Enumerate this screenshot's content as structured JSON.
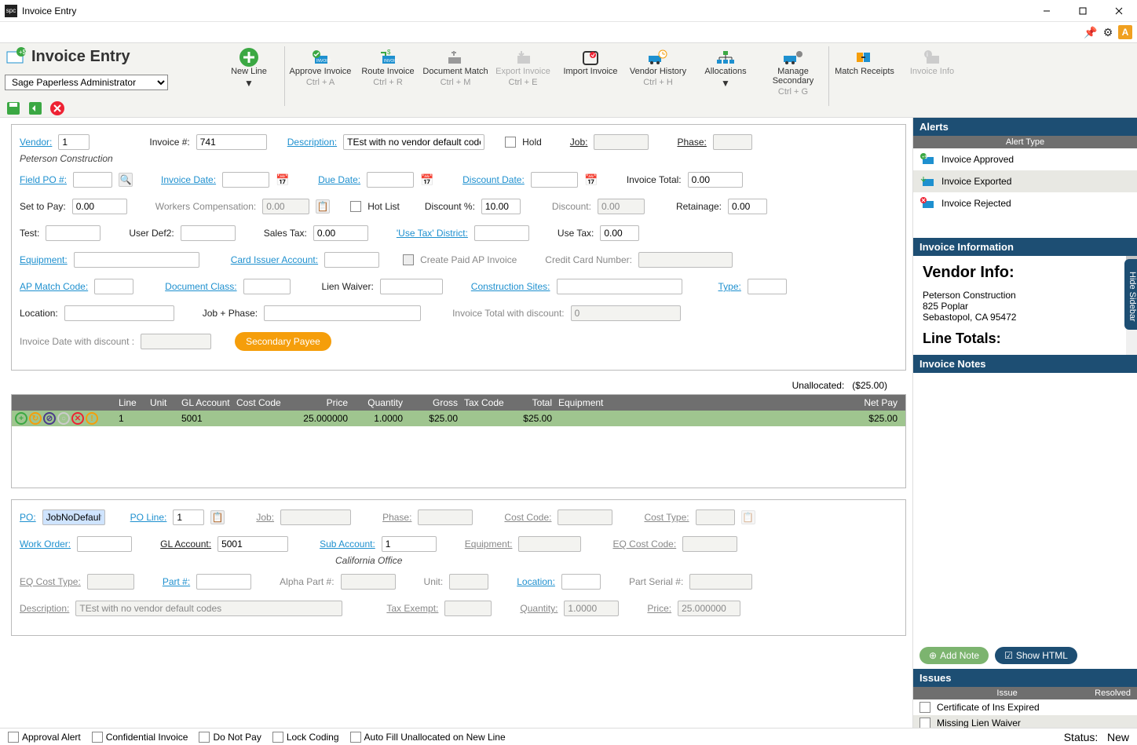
{
  "window": {
    "title": "Invoice Entry"
  },
  "page": {
    "title": "Invoice Entry",
    "admin": "Sage Paperless Administrator"
  },
  "tools": {
    "new_line": "New Line",
    "approve": "Approve Invoice",
    "approve_sc": "Ctrl + A",
    "route": "Route Invoice",
    "route_sc": "Ctrl + R",
    "docmatch": "Document Match",
    "docmatch_sc": "Ctrl + M",
    "export": "Export Invoice",
    "export_sc": "Ctrl + E",
    "import": "Import Invoice",
    "vendor_hist": "Vendor History",
    "vendor_hist_sc": "Ctrl + H",
    "alloc": "Allocations",
    "manage_sec": "Manage Secondary",
    "manage_sec_sc": "Ctrl + G",
    "match_rec": "Match Receipts",
    "inv_info": "Invoice Info"
  },
  "form": {
    "vendor_l": "Vendor:",
    "vendor_v": "1",
    "vendor_name": "Peterson Construction",
    "invno_l": "Invoice #:",
    "invno_v": "741",
    "desc_l": "Description:",
    "desc_v": "TEst with no vendor default codes",
    "hold_l": "Hold",
    "job_l": "Job:",
    "phase_l": "Phase:",
    "fieldpo_l": "Field PO #:",
    "invdate_l": "Invoice Date:",
    "duedate_l": "Due Date:",
    "discdate_l": "Discount Date:",
    "invtotal_l": "Invoice Total:",
    "invtotal_v": "0.00",
    "setpay_l": "Set to Pay:",
    "setpay_v": "0.00",
    "workcomp_l": "Workers Compensation:",
    "workcomp_v": "0.00",
    "hotlist_l": "Hot List",
    "discpct_l": "Discount %:",
    "discpct_v": "10.00",
    "discount_l": "Discount:",
    "discount_v": "0.00",
    "retain_l": "Retainage:",
    "retain_v": "0.00",
    "test_l": "Test:",
    "userdef2_l": "User Def2:",
    "salestax_l": "Sales Tax:",
    "salestax_v": "0.00",
    "usetaxdist_l": "'Use Tax' District:",
    "usetax_l": "Use Tax:",
    "usetax_v": "0.00",
    "equip_l": "Equipment:",
    "cardissuer_l": "Card Issuer Account:",
    "createpaid_l": "Create Paid AP Invoice",
    "ccnum_l": "Credit Card Number:",
    "apmatch_l": "AP Match Code:",
    "docclass_l": "Document Class:",
    "lienwaiver_l": "Lien Waiver:",
    "consites_l": "Construction Sites:",
    "type_l": "Type:",
    "location_l": "Location:",
    "jobphase_l": "Job + Phase:",
    "invtd_l": "Invoice Total with discount:",
    "invtd_v": "0",
    "invdd_l": "Invoice Date with discount :",
    "secpayee": "Secondary Payee"
  },
  "unallocated": {
    "label": "Unallocated:",
    "value": "($25.00)"
  },
  "grid": {
    "cols": [
      "Line",
      "Unit",
      "GL Account",
      "Cost Code",
      "Price",
      "Quantity",
      "Gross",
      "Tax Code",
      "Total",
      "Equipment",
      "Net Pay"
    ],
    "row": {
      "line": "1",
      "gl": "5001",
      "price": "25.000000",
      "qty": "1.0000",
      "gross": "$25.00",
      "total": "$25.00",
      "net": "$25.00"
    }
  },
  "detail": {
    "po_l": "PO:",
    "po_v": "JobNoDefault",
    "poline_l": "PO Line:",
    "poline_v": "1",
    "job_l": "Job:",
    "phase_l": "Phase:",
    "costcode_l": "Cost Code:",
    "costtype_l": "Cost Type:",
    "wo_l": "Work Order:",
    "gl_l": "GL Account:",
    "gl_v": "5001",
    "sub_l": "Sub Account:",
    "sub_v": "1",
    "sub_name": "California Office",
    "equip_l": "Equipment:",
    "eqcc_l": "EQ Cost Code:",
    "eqct_l": "EQ Cost Type:",
    "part_l": "Part #:",
    "alpha_l": "Alpha Part #:",
    "unit_l": "Unit:",
    "loc_l": "Location:",
    "serial_l": "Part Serial #:",
    "desc_l": "Description:",
    "desc_v": "TEst with no vendor default codes",
    "taxex_l": "Tax Exempt:",
    "qty_l": "Quantity:",
    "qty_v": "1.0000",
    "price_l": "Price:",
    "price_v": "25.000000"
  },
  "side": {
    "alerts_h": "Alerts",
    "alert_type": "Alert Type",
    "alerts": [
      "Invoice Approved",
      "Invoice Exported",
      "Invoice Rejected"
    ],
    "invinfo_h": "Invoice Information",
    "vendor_h": "Vendor Info:",
    "vendor_lines": [
      "Peterson Construction",
      "825 Poplar",
      "Sebastopol, CA 95472"
    ],
    "linetotals_h": "Line Totals:",
    "notes_h": "Invoice Notes",
    "add_note": "Add Note",
    "show_html": "Show HTML",
    "issues_h": "Issues",
    "issue_col": "Issue",
    "resolved_col": "Resolved",
    "issues": [
      "Certificate of Ins Expired",
      "Missing Lien Waiver"
    ],
    "hide_tab": "Hide Sidebar"
  },
  "footer": {
    "approval": "Approval Alert",
    "conf": "Confidential Invoice",
    "dnp": "Do Not Pay",
    "lock": "Lock Coding",
    "autofill": "Auto Fill Unallocated on New Line",
    "status_l": "Status:",
    "status_v": "New"
  }
}
